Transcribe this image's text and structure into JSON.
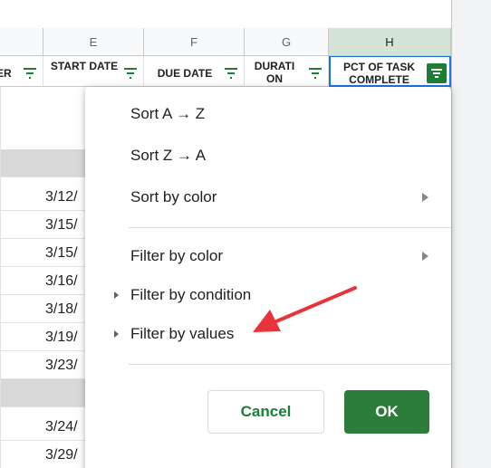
{
  "column_letters": [
    "E",
    "F",
    "G",
    "H"
  ],
  "headers": [
    {
      "id": "d",
      "label": "ER"
    },
    {
      "id": "e",
      "label": "START DATE"
    },
    {
      "id": "f",
      "label": "DUE DATE"
    },
    {
      "id": "g",
      "label": "DURATI ON"
    },
    {
      "id": "h",
      "label": "PCT OF TASK COMPLETE"
    }
  ],
  "rows": [
    {
      "type": "group",
      "date": ""
    },
    {
      "type": "data",
      "date": "3/12/"
    },
    {
      "type": "data",
      "date": "3/15/"
    },
    {
      "type": "data",
      "date": "3/15/"
    },
    {
      "type": "data",
      "date": "3/16/"
    },
    {
      "type": "data",
      "date": "3/18/"
    },
    {
      "type": "data",
      "date": "3/19/"
    },
    {
      "type": "data",
      "date": "3/23/"
    },
    {
      "type": "group",
      "date": ""
    },
    {
      "type": "data",
      "date": "3/24/"
    },
    {
      "type": "data",
      "date": "3/29/"
    }
  ],
  "menu": {
    "sort_az": "Sort A → Z",
    "sort_za": "Sort Z → A",
    "sort_by_color": "Sort by color",
    "filter_by_color": "Filter by color",
    "filter_by_condition": "Filter by condition",
    "filter_by_values": "Filter by values",
    "cancel": "Cancel",
    "ok": "OK"
  },
  "colors": {
    "accent_green": "#2d7d3a",
    "annotation_red": "#e8333a",
    "selection_blue": "#1a73e8"
  }
}
